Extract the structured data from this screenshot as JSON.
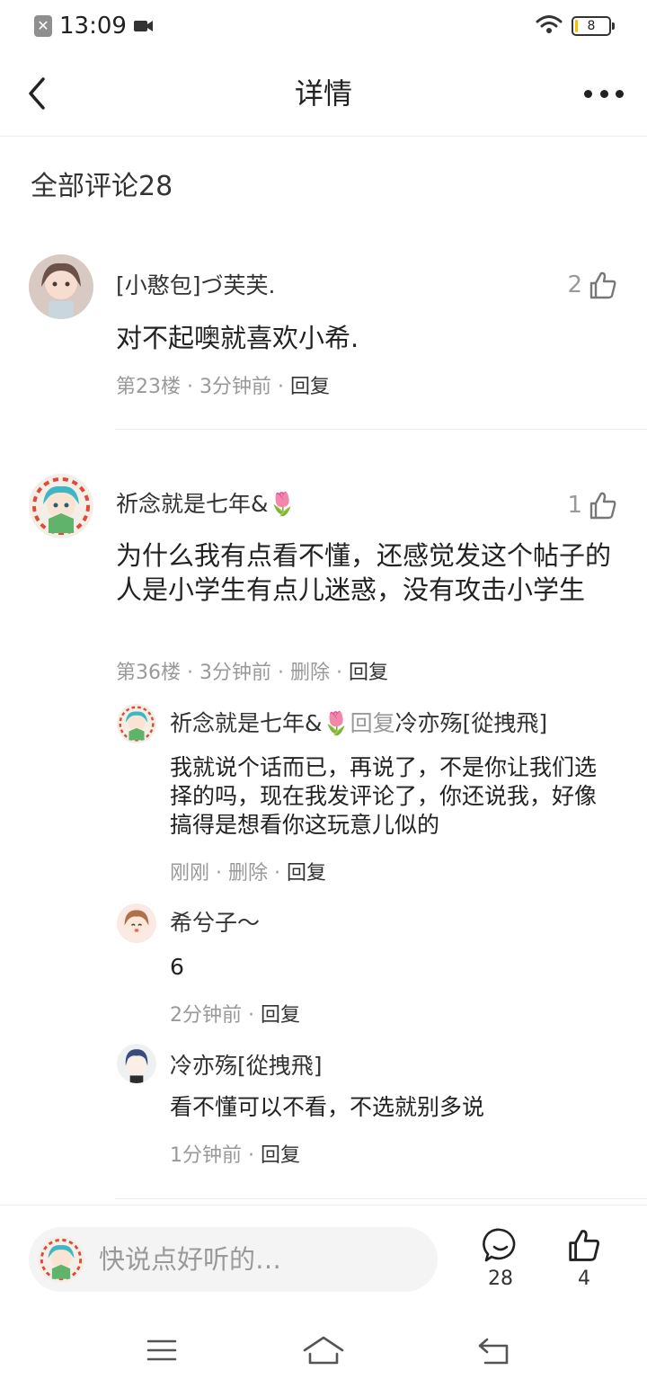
{
  "status_bar": {
    "time": "13:09",
    "battery": "8",
    "battery_level": 0.08
  },
  "header": {
    "title": "详情"
  },
  "comments_header": "全部评论28",
  "comments": [
    {
      "name": "[小憨包]づ芙芙.",
      "text": "对不起噢就喜欢小希.",
      "likes": "2",
      "floor": "第23楼",
      "time": "3分钟前",
      "reply": "回复"
    },
    {
      "name": "祈念就是七年&🌷",
      "text": "为什么我有点看不懂，还感觉发这个帖子的人是小学生有点儿迷惑，没有攻击小学生",
      "likes": "1",
      "floor": "第36楼",
      "time": "3分钟前",
      "delete": "删除",
      "reply": "回复",
      "replies": [
        {
          "name": "祈念就是七年&🌷",
          "reply_word": "回复",
          "target": "冷亦殇[從拽飛]",
          "text": "我就说个话而已，再说了，不是你让我们选择的吗，现在我发评论了，你还说我，好像搞得是想看你这玩意儿似的",
          "time": "刚刚",
          "delete": "删除",
          "reply": "回复"
        },
        {
          "name": "希兮子～",
          "text": "6",
          "time": "2分钟前",
          "reply": "回复"
        },
        {
          "name": "冷亦殇[從拽飛]",
          "text": "看不懂可以不看，不选就别多说",
          "time": "1分钟前",
          "reply": "回复"
        }
      ]
    }
  ],
  "bottom_bar": {
    "placeholder": "快说点好听的…",
    "comment_count": "28",
    "like_count": "4"
  },
  "icons": {
    "back": "chevron-left-icon",
    "more": "more-dots-icon",
    "like": "thumbs-up-icon",
    "comment": "comment-bubble-icon",
    "menu": "menu-icon",
    "home": "home-icon",
    "return": "return-icon",
    "wifi": "wifi-icon",
    "camera": "video-camera-icon",
    "notification": "notification-x-icon"
  }
}
